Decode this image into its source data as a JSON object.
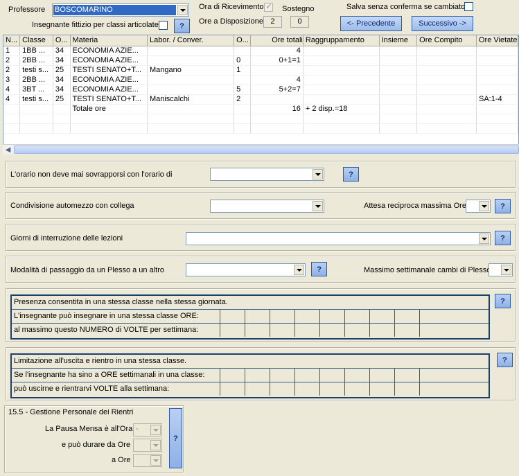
{
  "header": {
    "professore_label": "Professore",
    "professore_value": "BOSCOMARINO",
    "fittizio_label": "Insegnante fittizio per classi articolate",
    "help_label": "?",
    "ora_ricevimento_label": "Ora di Ricevimento",
    "sostegno_label": "Sostegno",
    "ore_disposizione_label": "Ore a Disposizione",
    "ore_disposizione_1": "2",
    "ore_disposizione_2": "0",
    "salva_label": "Salva senza conferma se cambiato",
    "precedente_label": "<- Precedente",
    "successivo_label": "Successivo ->"
  },
  "grid": {
    "columns": [
      "N...",
      "Classe",
      "O...",
      "Materia",
      "Labor. / Conver.",
      "O...",
      "Ore totali",
      "Raggruppamento",
      "Insieme",
      "Ore Compito",
      "Ore Vietate"
    ],
    "rows": [
      [
        "1",
        "1BB ...",
        "34",
        "ECONOMIA AZIE...",
        "",
        "",
        "4",
        "",
        "",
        "",
        ""
      ],
      [
        "2",
        "2BB ...",
        "34",
        "ECONOMIA AZIE...",
        "",
        "0",
        "0+1=1",
        "",
        "",
        "",
        ""
      ],
      [
        "2",
        "testi s...",
        "25",
        "TESTI SENATO+T...",
        "Mangano",
        "1",
        "",
        "",
        "",
        "",
        ""
      ],
      [
        "3",
        "2BB ...",
        "34",
        "ECONOMIA AZIE...",
        "",
        "",
        "4",
        "",
        "",
        "",
        ""
      ],
      [
        "4",
        "3BT ...",
        "34",
        "ECONOMIA AZIE...",
        "",
        "5",
        "5+2=7",
        "",
        "",
        "",
        ""
      ],
      [
        "4",
        "testi s...",
        "25",
        "TESTI SENATO+T...",
        "Maniscalchi",
        "2",
        "",
        "",
        "",
        "",
        "SA:1-4"
      ],
      [
        "",
        "",
        "",
        "Totale ore",
        "",
        "",
        "16",
        "+ 2 disp.=18",
        "",
        "",
        ""
      ]
    ]
  },
  "panels": {
    "orario_label": "L'orario non deve mai sovrapporsi con l'orario di",
    "condivisione_label": "Condivisione automezzo con collega",
    "attesa_label": "Attesa reciproca massima Ore",
    "giorni_label": "Giorni di interruzione delle lezioni",
    "modalita_label": "Modalità di passaggio da un Plesso a un altro",
    "massimo_plesso_label": "Massimo settimanale cambi di Plesso",
    "presenza_title": "Presenza consentita in una stessa classe nella stessa giornata.",
    "presenza_row1": "L'insegnante può insegnare in una stessa classe ORE:",
    "presenza_row2": "al massimo questo NUMERO di VOLTE per settimana:",
    "limitazione_title": "Limitazione all'uscita e rientro in una stessa classe.",
    "limitazione_row1": "Se l'insegnante ha sino a ORE settimanali in una classe:",
    "limitazione_row2": "può uscirne e rientrarvi VOLTE alla settimana:"
  },
  "rientri": {
    "title": "15.5 - Gestione Personale dei Rientri",
    "pausa_label": "La Pausa Mensa è all'Ora",
    "pausa_value": "-",
    "durare_label": "e può durare da Ore",
    "a_ore_label": "a Ore",
    "help_label": "?"
  },
  "colors": {
    "accent": "#316ac5",
    "button": "#9dbbea",
    "table_border": "#1c3f6e"
  }
}
